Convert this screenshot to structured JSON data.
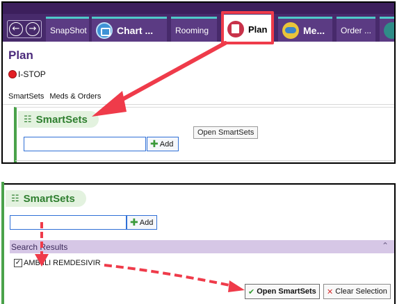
{
  "tabs": [
    {
      "label": "SnapShot",
      "icon": "none"
    },
    {
      "label": "Chart ...",
      "icon": "chart-review-icon"
    },
    {
      "label": "Rooming",
      "icon": "none"
    },
    {
      "label": "Plan",
      "icon": "plan-icon",
      "active": true
    },
    {
      "label": "Me...",
      "icon": "medications-icon"
    },
    {
      "label": "Order ...",
      "icon": "none"
    },
    {
      "label": "",
      "icon": "activity-icon"
    }
  ],
  "nav": {
    "back": "←",
    "forward": "→"
  },
  "plan": {
    "title": "Plan",
    "istop_label": "I-STOP",
    "subnav": [
      "SmartSets",
      "Meds & Orders"
    ]
  },
  "top_smartsets": {
    "title": "SmartSets",
    "add_label": "Add",
    "search_value": "",
    "tooltip": "Open SmartSets"
  },
  "bottom_smartsets": {
    "title": "SmartSets",
    "add_label": "Add",
    "search_value": "",
    "results_header": "Search Results",
    "result_item": "AMB ILI REMDESIVIR",
    "result_checked": true,
    "open_button": "Open SmartSets",
    "clear_button": "Clear Selection"
  },
  "colors": {
    "tabbar": "#472a6b",
    "highlight": "#ef3b4a",
    "section_green": "#4aa24a",
    "results_bar": "#d6c7e6"
  }
}
